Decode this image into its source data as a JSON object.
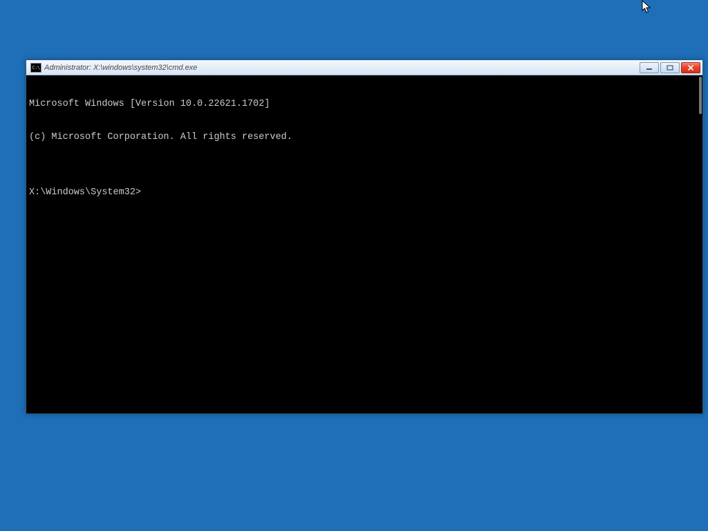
{
  "window": {
    "title": "Administrator: X:\\windows\\system32\\cmd.exe",
    "icon_label": "C:\\"
  },
  "terminal": {
    "line1": "Microsoft Windows [Version 10.0.22621.1702]",
    "line2": "(c) Microsoft Corporation. All rights reserved.",
    "blank": "",
    "prompt": "X:\\Windows\\System32>"
  }
}
